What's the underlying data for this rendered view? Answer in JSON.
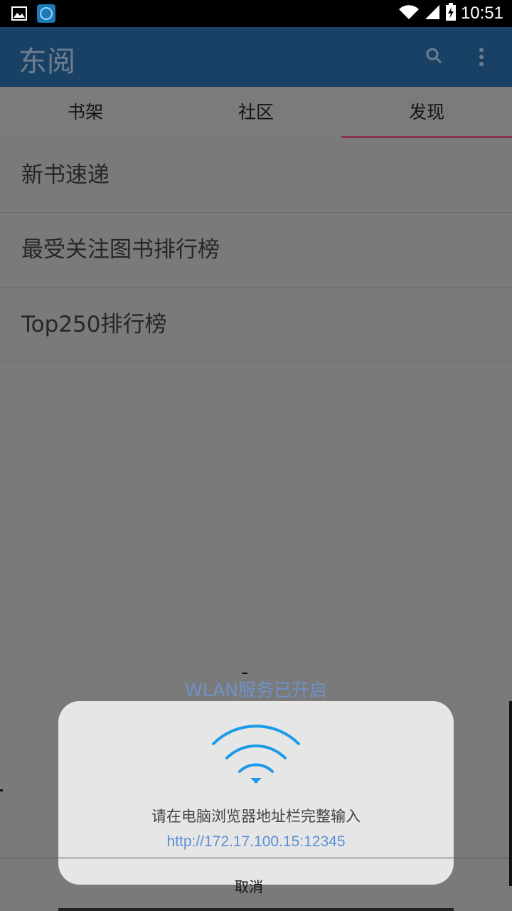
{
  "status_bar": {
    "time": "10:51",
    "icons": [
      "image-icon",
      "app-icon",
      "wifi-icon",
      "signal-icon",
      "battery-charging-icon"
    ]
  },
  "app_bar": {
    "title": "东阅",
    "actions": [
      "search-icon",
      "more-vert-icon"
    ]
  },
  "tabs": [
    {
      "label": "书架",
      "active": false
    },
    {
      "label": "社区",
      "active": false
    },
    {
      "label": "发现",
      "active": true
    }
  ],
  "list": {
    "items": [
      {
        "label": "新书速递"
      },
      {
        "label": "最受关注图书排行榜"
      },
      {
        "label": "Top250排行榜"
      }
    ]
  },
  "dialog": {
    "title": "WLAN服务已开启",
    "message": "请在电脑浏览器地址栏完整输入",
    "url": "http://172.17.100.15:12345",
    "cancel_label": "取消",
    "icon": "wifi-icon",
    "accent_color": "#1a9ae8"
  },
  "colors": {
    "app_bar": "#194166",
    "tab_indicator": "#8a3550",
    "scrim": "#7a7a7a"
  }
}
